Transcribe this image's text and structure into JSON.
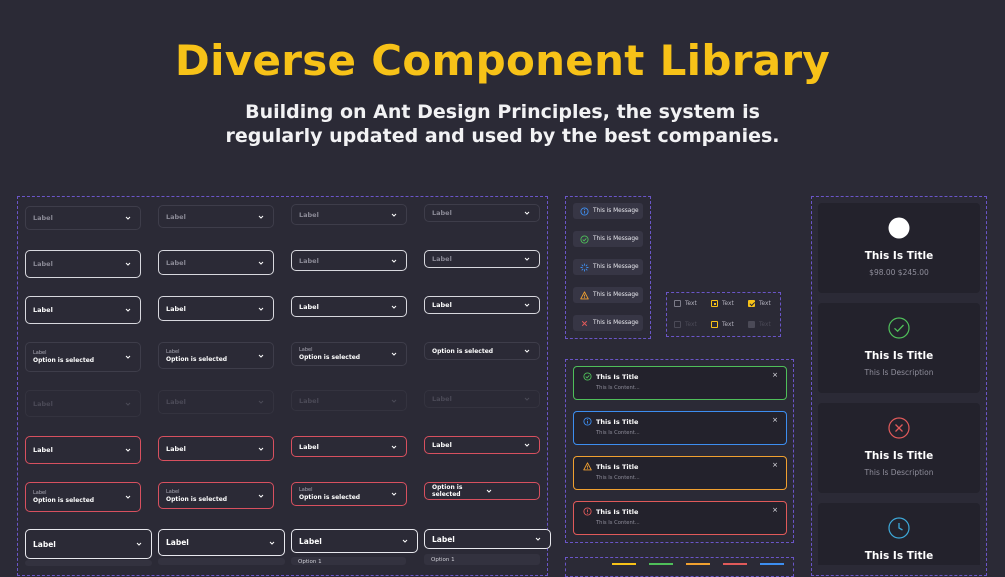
{
  "hero": {
    "title": "Diverse Component Library",
    "subtitle_line1": "Building on Ant Design Principles, the system is",
    "subtitle_line2": "regularly updated and used by the best companies."
  },
  "selects": {
    "label": "Label",
    "small_label": "Label",
    "selected": "Option is selected",
    "menu_option": "Option 1"
  },
  "messages": [
    {
      "icon": "info-icon",
      "text": "This is Message",
      "color": "#3d8ef0"
    },
    {
      "icon": "success-icon",
      "text": "This is Message",
      "color": "#4fbf5a"
    },
    {
      "icon": "loading-icon",
      "text": "This is Message",
      "color": "#3d8ef0"
    },
    {
      "icon": "warning-icon",
      "text": "This is Message",
      "color": "#f0a030"
    },
    {
      "icon": "error-icon",
      "text": "This is Message",
      "color": "#e05a5a"
    }
  ],
  "checkboxes": {
    "text": "Text"
  },
  "alerts": [
    {
      "type": "success",
      "title": "This Is Title",
      "content": "This Is Content...",
      "close": "×",
      "color": "#4fbf5a"
    },
    {
      "type": "info",
      "title": "This Is Title",
      "content": "This Is Content...",
      "close": "×",
      "color": "#3d8ef0"
    },
    {
      "type": "warning",
      "title": "This Is Title",
      "content": "This Is Content...",
      "close": "×",
      "color": "#f0a030"
    },
    {
      "type": "error",
      "title": "This Is Title",
      "content": "This Is Content...",
      "close": "×",
      "color": "#e05a5a"
    }
  ],
  "cards": [
    {
      "icon": "avatar-circle",
      "title": "This Is Title",
      "desc": "$98.00 $245.00"
    },
    {
      "icon": "success-circle-icon",
      "title": "This Is Title",
      "desc": "This Is Description",
      "color": "#4fbf5a"
    },
    {
      "icon": "error-circle-icon",
      "title": "This Is Title",
      "desc": "This Is Description",
      "color": "#e05a5a"
    },
    {
      "icon": "clock-icon",
      "title": "This Is Title",
      "desc": "",
      "color": "#3da8d8"
    }
  ],
  "colors": {
    "accent": "#f7c218",
    "frame": "#6a55c8",
    "background": "#2b2a36"
  }
}
